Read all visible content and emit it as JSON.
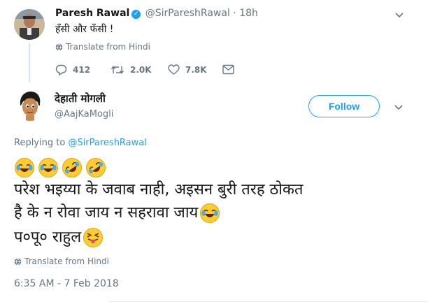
{
  "parent_tweet": {
    "name": "Paresh Rawal",
    "handle": "@SirPareshRawal",
    "separator": "·",
    "time": "18h",
    "text": "हँसी और फँसी !",
    "translate": "Translate from Hindi",
    "actions": {
      "replies": "412",
      "retweets": "2.0K",
      "likes": "7.8K"
    }
  },
  "main_tweet": {
    "name": "देहाती मोगली",
    "handle": "@AajKaMogli",
    "follow_label": "Follow",
    "replying_prefix": "Replying to",
    "replying_to": "@SirPareshRawal",
    "line1": "परेश भइय्या के जवाब नाही, अइसन बुरी तरह ठोकत",
    "line2": "है के न रोवा जाय न सहरावा जाय",
    "line3": "प०पू० राहुल",
    "translate": "Translate from Hindi",
    "timestamp": "6:35 AM - 7 Feb 2018"
  },
  "icons": {
    "verified": "verified-badge-icon",
    "chevron": "chevron-down-icon",
    "globe": "globe-icon",
    "reply": "reply-icon",
    "retweet": "retweet-icon",
    "like": "heart-icon",
    "dm": "envelope-icon",
    "emojis": [
      "joy-emoji-icon",
      "joy-emoji-icon",
      "rofl-emoji-icon",
      "rofl-emoji-icon"
    ]
  },
  "colors": {
    "accent": "#1da1f2",
    "muted": "#657786",
    "text": "#14171a",
    "thread_line": "#cfe4f5"
  }
}
